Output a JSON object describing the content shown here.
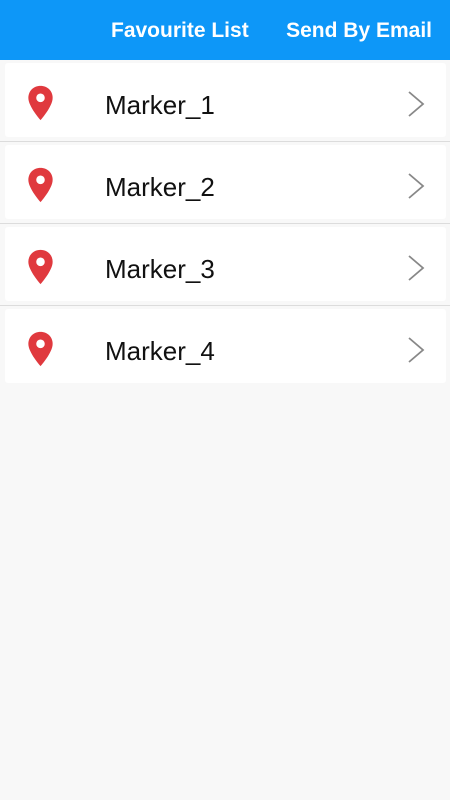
{
  "header": {
    "title": "Favourite List",
    "action_label": "Send By Email"
  },
  "colors": {
    "app_bar": "#0d97f8",
    "pin": "#e0393e",
    "chevron": "#888888"
  },
  "list": {
    "items": [
      {
        "label": "Marker_1",
        "icon": "map-marker-icon"
      },
      {
        "label": "Marker_2",
        "icon": "map-marker-icon"
      },
      {
        "label": "Marker_3",
        "icon": "map-marker-icon"
      },
      {
        "label": "Marker_4",
        "icon": "map-marker-icon"
      }
    ]
  }
}
